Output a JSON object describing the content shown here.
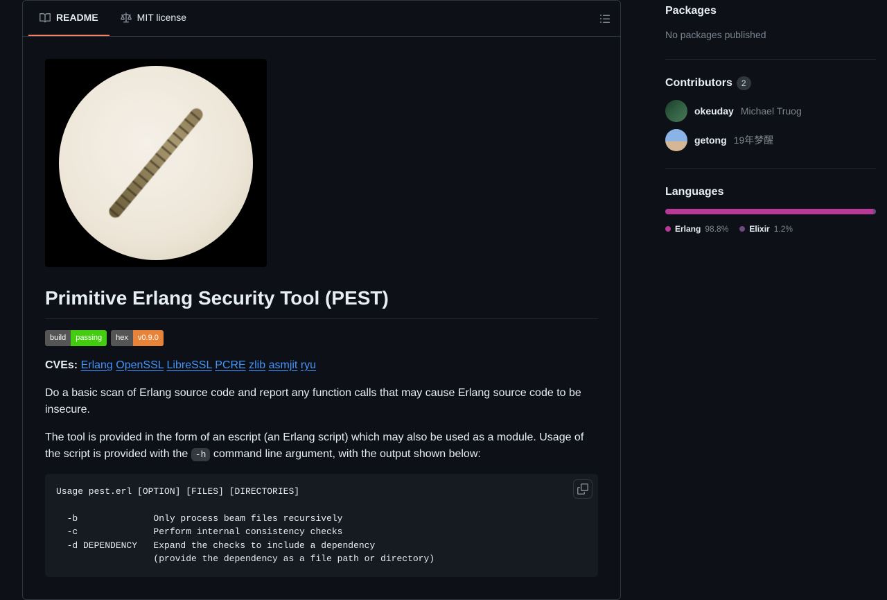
{
  "tabs": {
    "readme": "README",
    "license": "MIT license"
  },
  "readme": {
    "title": "Primitive Erlang Security Tool (PEST)",
    "badges": {
      "build_key": "build",
      "build_val": "passing",
      "hex_key": "hex",
      "hex_val": "v0.9.0"
    },
    "cve_label": "CVEs:",
    "cve_links": [
      "Erlang",
      "OpenSSL",
      "LibreSSL",
      "PCRE",
      "zlib",
      "asmjit",
      "ryu"
    ],
    "para1": "Do a basic scan of Erlang source code and report any function calls that may cause Erlang source code to be insecure.",
    "para2a": "The tool is provided in the form of an escript (an Erlang script) which may also be used as a module. Usage of the script is provided with the ",
    "para2_code": "-h",
    "para2b": " command line argument, with the output shown below:",
    "usage": "Usage pest.erl [OPTION] [FILES] [DIRECTORIES]\n\n  -b              Only process beam files recursively\n  -c              Perform internal consistency checks\n  -d DEPENDENCY   Expand the checks to include a dependency\n                  (provide the dependency as a file path or directory)"
  },
  "sidebar": {
    "packages_title": "Packages",
    "packages_empty": "No packages published",
    "contributors_title": "Contributors",
    "contributors_count": "2",
    "contributors": [
      {
        "user": "okeuday",
        "name": "Michael Truog"
      },
      {
        "user": "getong",
        "name": "19年梦醒"
      }
    ],
    "languages_title": "Languages",
    "languages": [
      {
        "name": "Erlang",
        "pct": "98.8%",
        "color": "#b83998",
        "width": "98.8%"
      },
      {
        "name": "Elixir",
        "pct": "1.2%",
        "color": "#6e4a7e",
        "width": "1.2%"
      }
    ]
  }
}
